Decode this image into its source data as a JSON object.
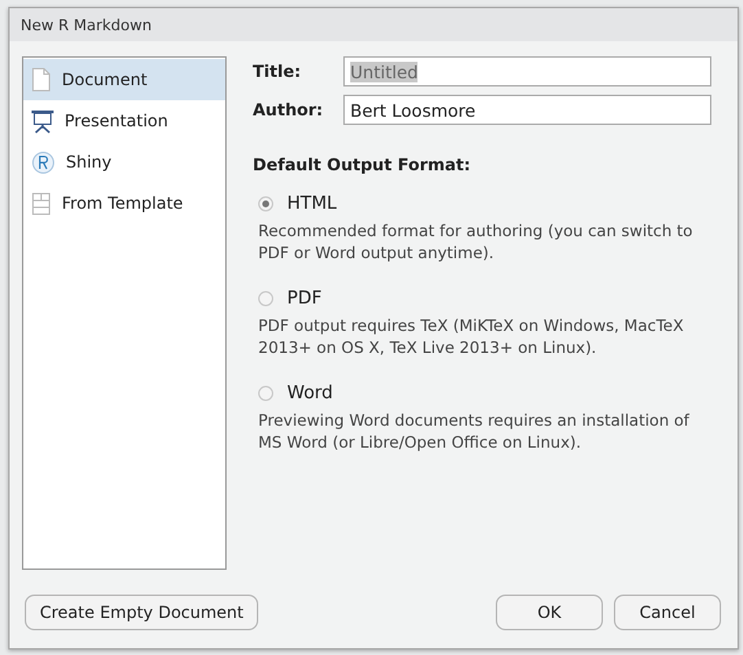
{
  "window": {
    "title": "New R Markdown"
  },
  "sidebar": {
    "items": [
      {
        "label": "Document",
        "kind": "document",
        "selected": true
      },
      {
        "label": "Presentation",
        "kind": "presentation",
        "selected": false
      },
      {
        "label": "Shiny",
        "kind": "shiny",
        "selected": false
      },
      {
        "label": "From Template",
        "kind": "template",
        "selected": false
      }
    ]
  },
  "fields": [
    {
      "label": "Title:",
      "value": "Untitled",
      "highlighted": true
    },
    {
      "label": "Author:",
      "value": "Bert Loosmore",
      "highlighted": false
    }
  ],
  "output_format": {
    "heading": "Default Output Format:",
    "options": [
      {
        "label": "HTML",
        "selected": true,
        "description": "Recommended format for authoring (you can switch to PDF or Word output anytime)."
      },
      {
        "label": "PDF",
        "selected": false,
        "description": "PDF output requires TeX (MiKTeX on Windows, MacTeX 2013+ on OS X, TeX Live 2013+ on Linux)."
      },
      {
        "label": "Word",
        "selected": false,
        "description": "Previewing Word documents requires an installation of MS Word (or Libre/Open Office on Linux)."
      }
    ]
  },
  "buttons": {
    "left": "Create Empty Document",
    "ok": "OK",
    "cancel": "Cancel"
  }
}
